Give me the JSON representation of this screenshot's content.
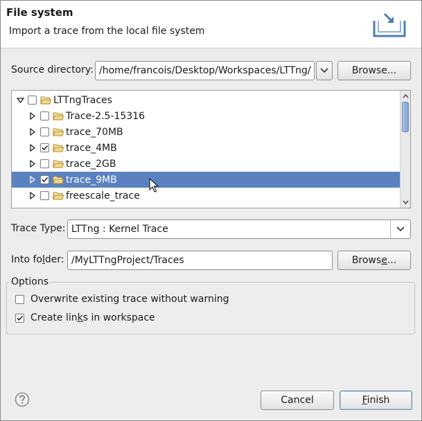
{
  "header": {
    "title": "File system",
    "subtitle": "Import a trace from the local file system"
  },
  "source": {
    "label_pre": "Source directory:",
    "value": "/home/francois/Desktop/Workspaces/LTTng/",
    "browse_pre": "Browse..."
  },
  "tree": {
    "items": [
      {
        "label": "LTTngTraces",
        "level": 0,
        "expanded": true,
        "checked": false,
        "selected": false
      },
      {
        "label": "Trace-2.5-15316",
        "level": 1,
        "expanded": false,
        "checked": false,
        "selected": false
      },
      {
        "label": "trace_70MB",
        "level": 1,
        "expanded": false,
        "checked": false,
        "selected": false
      },
      {
        "label": "trace_4MB",
        "level": 1,
        "expanded": false,
        "checked": true,
        "selected": false
      },
      {
        "label": "trace_2GB",
        "level": 1,
        "expanded": false,
        "checked": false,
        "selected": false
      },
      {
        "label": "trace_9MB",
        "level": 1,
        "expanded": false,
        "checked": true,
        "selected": true
      },
      {
        "label": "freescale_trace",
        "level": 1,
        "expanded": false,
        "checked": false,
        "selected": false
      }
    ]
  },
  "trace_type": {
    "label": "Trace Type:",
    "value": "LTTng : Kernel Trace"
  },
  "into_folder": {
    "label_pre": "Into fo",
    "label_mn": "l",
    "label_post": "der:",
    "value": "/MyLTTngProject/Traces",
    "browse_pre": "Brows",
    "browse_mn": "e",
    "browse_post": "..."
  },
  "options": {
    "title": "Options",
    "overwrite_label": "Overwrite existing trace without warning",
    "overwrite_checked": false,
    "links_pre": "Create lin",
    "links_mn": "k",
    "links_post": "s in workspace",
    "links_checked": true
  },
  "footer": {
    "help_icon": "question-mark-icon",
    "cancel_label": "Cancel",
    "finish_mn": "F",
    "finish_post": "inish"
  }
}
